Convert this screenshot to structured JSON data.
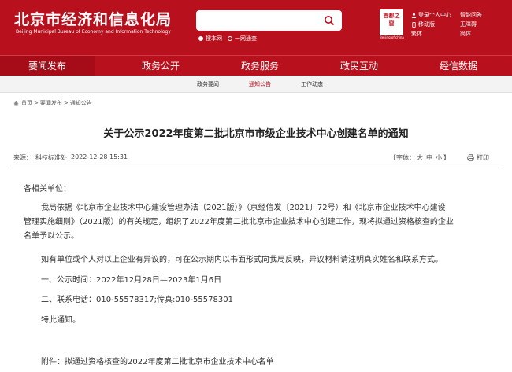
{
  "header": {
    "title": "北京市经济和信息化局",
    "subtitle": "Beijing Municipal Bureau of Economy and Information Technology",
    "search": {
      "placeholder": ""
    },
    "scope_options": [
      "搜本网",
      "一网通查"
    ],
    "emblem": {
      "text": "首都之窗",
      "sub": "Beijing of china"
    },
    "links": [
      {
        "label": "登录个人中心",
        "icon": "user-icon"
      },
      {
        "label": "移动版",
        "icon": "mobile-icon"
      },
      {
        "label": "繁体",
        "icon": ""
      },
      {
        "label": "智能问答",
        "icon": ""
      },
      {
        "label": "无障碍",
        "icon": ""
      },
      {
        "label": "简体",
        "icon": ""
      }
    ]
  },
  "nav": {
    "items": [
      "要闻发布",
      "政务公开",
      "政务服务",
      "政民互动",
      "经信数据"
    ],
    "active": "要闻发布"
  },
  "subnav": {
    "items": [
      "政务要闻",
      "通知公告",
      "工作动态"
    ],
    "active": "通知公告"
  },
  "breadcrumb": [
    "首页",
    "要闻发布",
    "通知公告"
  ],
  "article": {
    "title": "关于公示2022年度第二批北京市市级企业技术中心创建名单的通知",
    "source_label": "来源：",
    "source": "科技标准处",
    "date": "2022-12-28 15:31",
    "font_label_open": "【字体：",
    "font_sizes": [
      "大",
      "中",
      "小"
    ],
    "font_label_close": "】",
    "print_label": "打印",
    "salutation": "各相关单位：",
    "body_lines": [
      "我局依据《北京市企业技术中心建设管理办法（2021版）》（京经信发〔2021〕72号）和《北京市企业技术中心建设",
      "管理实施细则》（2021版）的有关规定，组织了2022年度第二批北京市企业技术中心创建工作，现将拟通过资格核查的企业",
      "名单予以公示。"
    ],
    "objection": "如有单位或个人对以上企业有异议的，可在公示期内以书面形式向我局反映，异议材料请注明真实姓名和联系方式。",
    "time": "一、公示时间：2022年12月28日—2023年1月6日",
    "phone": "二、联系电话：010-55578317;传真:010-55578301",
    "closing": "特此通知。",
    "attachment": "附件：拟通过资格核查的2022年度第二批北京市企业技术中心名单"
  },
  "colors": {
    "brand_red": "#b8101d",
    "active_nav": "#a50c18",
    "subnav_bg": "#f3f3f3"
  }
}
